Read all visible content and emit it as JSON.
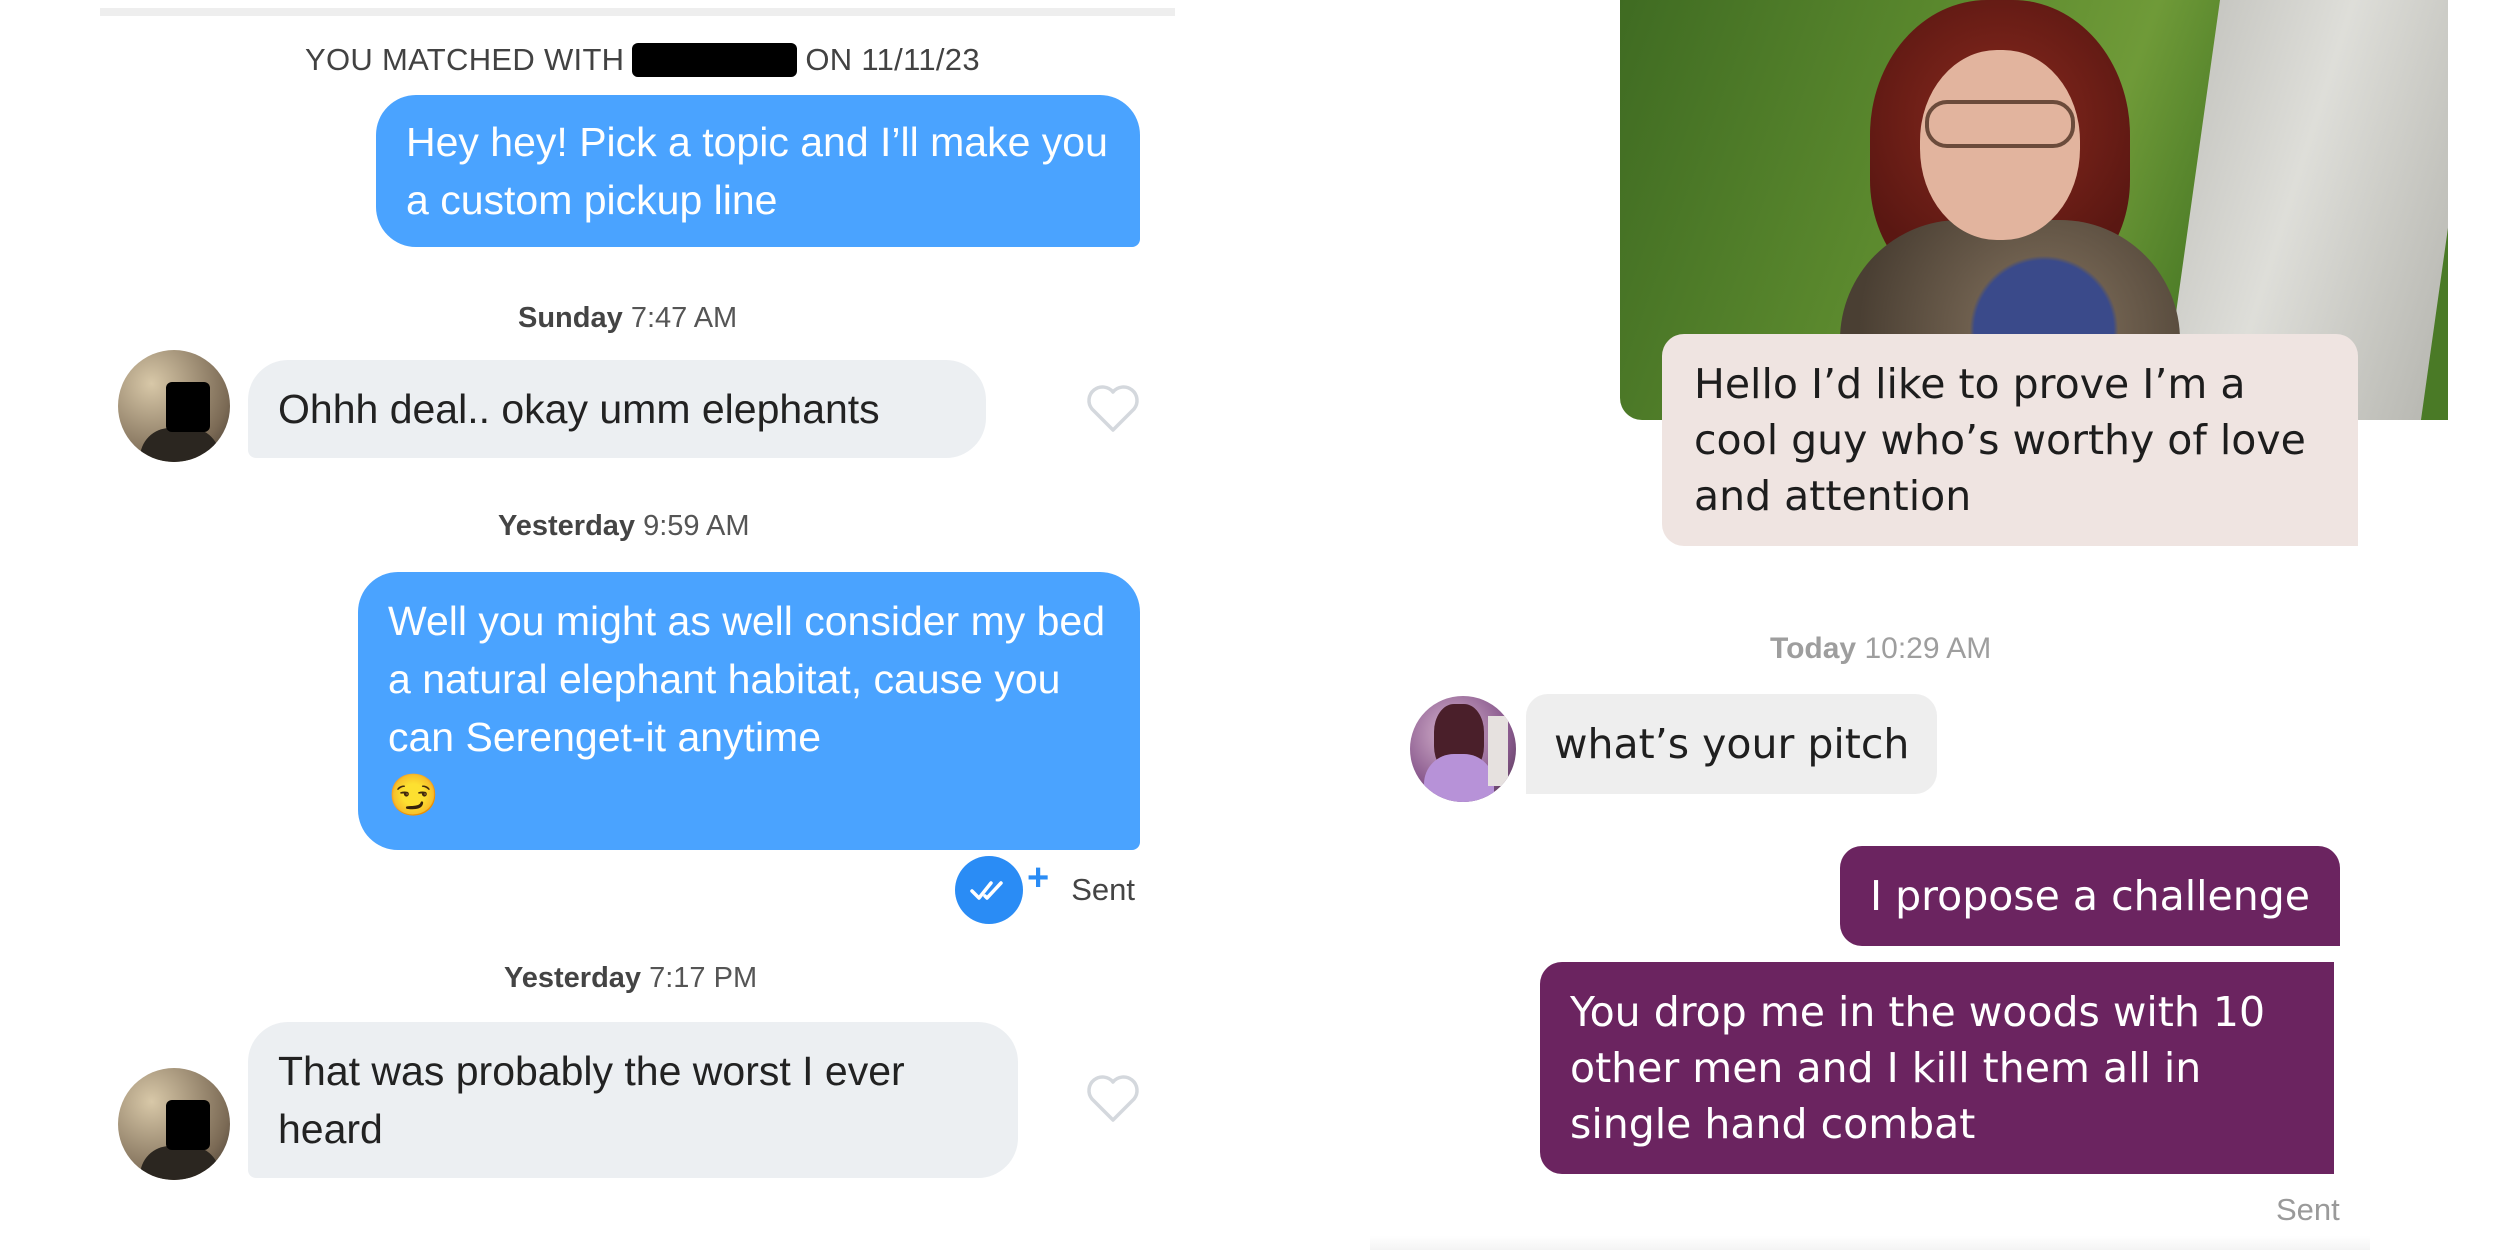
{
  "left_chat": {
    "match_prefix": "YOU MATCHED WITH",
    "match_suffix": "ON 11/11/23",
    "messages": [
      {
        "text": "Hey hey! Pick a topic and I’ll make you a custom pickup line"
      },
      {
        "day": "Sunday",
        "time": "7:47 AM"
      },
      {
        "text": "Ohhh deal.. okay umm elephants"
      },
      {
        "day": "Yesterday",
        "time": "9:59 AM"
      },
      {
        "text": "Well you might as well consider my bed a natural elephant habitat, cause you can Serenget-it anytime",
        "emoji": "😏"
      },
      {
        "day": "Yesterday",
        "time": "7:17 PM"
      },
      {
        "text": "That was probably the worst I ever heard"
      }
    ],
    "sent_label": "Sent",
    "plus_symbol": "+",
    "colors": {
      "outgoing": "#4aa3ff",
      "incoming": "#eceff2",
      "read_check": "#2a8cf5"
    }
  },
  "right_chat": {
    "messages": [
      {
        "text": "Hello I’d like to prove I’m a cool guy who’s worthy of love and attention"
      },
      {
        "day": "Today",
        "time": "10:29 AM"
      },
      {
        "text": "what’s your pitch"
      },
      {
        "text": "I propose a challenge"
      },
      {
        "text": "You drop me in the woods with 10 other men and I kill them all in single hand combat"
      }
    ],
    "sent_label": "Sent",
    "colors": {
      "outgoing": "#6b2460",
      "incoming": "#eeeeee",
      "prompt_reply": "#efe4e1"
    }
  }
}
